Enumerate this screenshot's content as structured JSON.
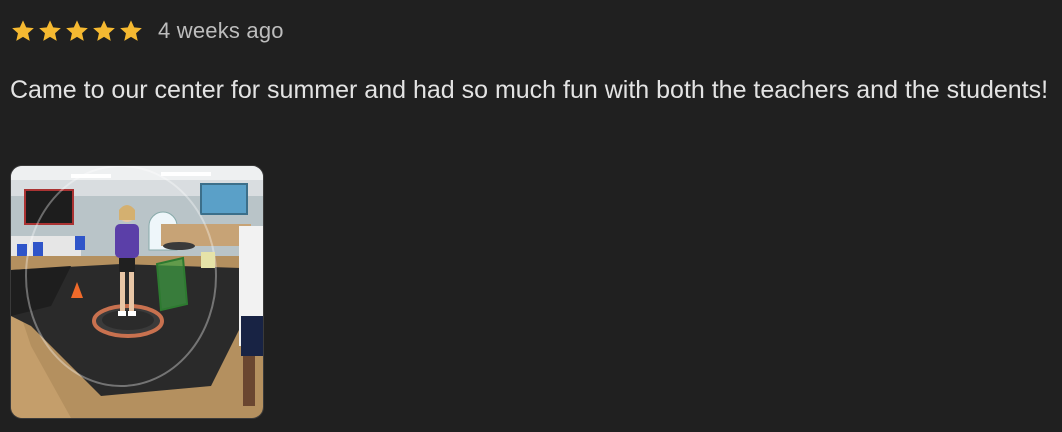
{
  "review": {
    "rating": 5,
    "max_rating": 5,
    "star_icon": "star-icon",
    "star_color": "#F5B931",
    "time_ago": "4 weeks ago",
    "text": "Came to our center for summer and had so much fun with both the teachers and the students!",
    "photo": {
      "icon": "review-photo"
    }
  }
}
